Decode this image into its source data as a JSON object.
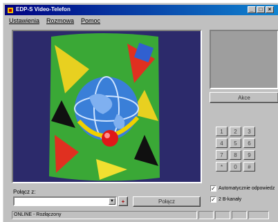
{
  "window": {
    "title": "EDP-S Video-Telefon"
  },
  "titlebar": {
    "minimize_glyph": "_",
    "maximize_glyph": "□",
    "close_glyph": "×"
  },
  "menu": {
    "items": [
      "Ustawienia",
      "Rozmowa",
      "Pomoc"
    ]
  },
  "preview": {
    "button_label": "Akce"
  },
  "keypad": {
    "keys": [
      "1",
      "2",
      "3",
      "4",
      "5",
      "6",
      "7",
      "8",
      "9",
      "*",
      "0",
      "#"
    ]
  },
  "call": {
    "label": "Połącz z:",
    "input_value": "",
    "connect_label": "Połącz",
    "plus_glyph": "+"
  },
  "options": {
    "auto_answer_label": "Automatycznie odpowiedz",
    "auto_answer_checked": true,
    "second_label": "2 B-kanały",
    "second_checked": true
  },
  "status": {
    "text": "ONLINE - Rozłączony",
    "panes": [
      "",
      "",
      "",
      ""
    ]
  },
  "icons": {
    "app": "app-icon",
    "dropdown": "chevron-down-icon",
    "check": "✓"
  },
  "colors": {
    "titlebar_start": "#000080",
    "titlebar_end": "#1084d0",
    "video_bg": "#2c2a6b",
    "preview_bg": "#9e9e9e"
  }
}
